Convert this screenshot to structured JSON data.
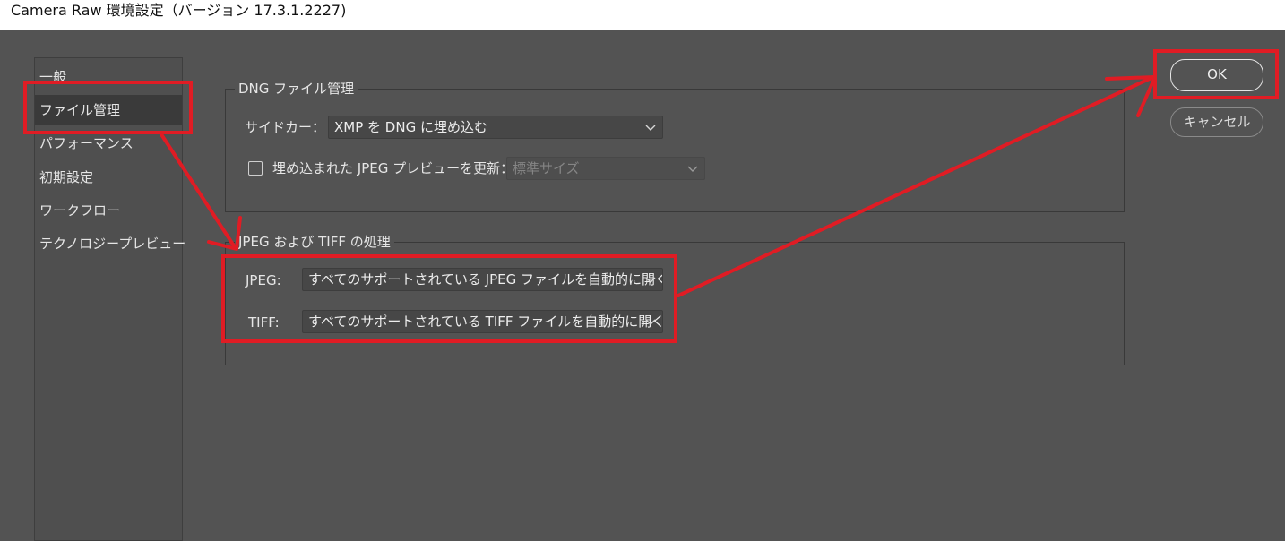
{
  "window": {
    "title": "Camera Raw 環境設定（バージョン 17.3.1.2227)"
  },
  "sidebar": {
    "items": [
      {
        "label": "一般"
      },
      {
        "label": "ファイル管理",
        "selected": true
      },
      {
        "label": "パフォーマンス"
      },
      {
        "label": "初期設定"
      },
      {
        "label": "ワークフロー"
      },
      {
        "label": "テクノロジープレビュー"
      }
    ]
  },
  "dng_section": {
    "title": "DNG ファイル管理",
    "sidecar_label": "サイドカー：",
    "sidecar_value": "XMP を DNG に埋め込む",
    "embed_preview_label": "埋め込まれた JPEG プレビューを更新：",
    "embed_preview_checked": false,
    "preview_size_value": "標準サイズ"
  },
  "jpeg_tiff_section": {
    "title": "JPEG および TIFF の処理",
    "jpeg_label": "JPEG:",
    "jpeg_value": "すべてのサポートされている JPEG ファイルを自動的に開く",
    "tiff_label": "TIFF:",
    "tiff_value": "すべてのサポートされている TIFF ファイルを自動的に開く"
  },
  "buttons": {
    "ok_label": "OK",
    "cancel_label": "キャンセル"
  },
  "colors": {
    "background": "#535353",
    "highlight": "#e01c24"
  },
  "icons": [
    "chevron-down-icon",
    "checkbox-icon"
  ]
}
